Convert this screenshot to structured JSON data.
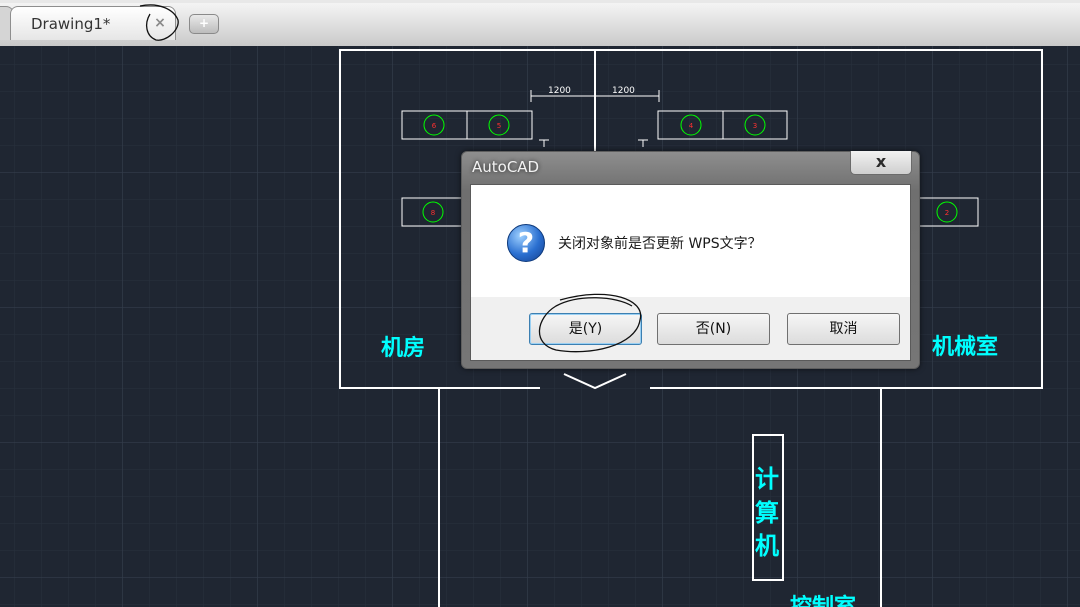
{
  "tabs": [
    {
      "label": "Drawing1*",
      "close_glyph": "×",
      "active": true
    }
  ],
  "new_tab_glyph": "+",
  "drawing": {
    "dimensions": [
      "1200",
      "1200"
    ],
    "circle_labels_top": [
      "6",
      "5",
      "4",
      "3"
    ],
    "circle_labels_mid": [
      "8",
      "2"
    ],
    "room_labels": {
      "left": "机房",
      "right": "机械室",
      "vertical": [
        "计",
        "算",
        "机"
      ],
      "bottom": "控制室"
    }
  },
  "dialog": {
    "title": "AutoCAD",
    "close_glyph": "x",
    "icon": "question-icon",
    "icon_glyph": "?",
    "message": "关闭对象前是否更新 WPS文字？",
    "buttons": {
      "yes": "是(Y)",
      "no": "否(N)",
      "cancel": "取消"
    }
  },
  "colors": {
    "canvas_background": "#1f2632",
    "grid": "#2e3644",
    "linework": "#ffffff",
    "cyan_text": "#00ffff",
    "circle_green": "#00ff00",
    "circle_text_red": "#ff3030"
  }
}
